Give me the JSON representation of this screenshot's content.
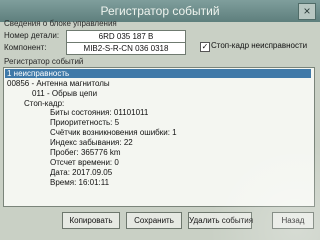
{
  "window": {
    "title": "Регистратор событий",
    "close_glyph": "×"
  },
  "control_unit": {
    "group_label": "Сведения о блоке управления",
    "part_number_label": "Номер детали:",
    "part_number": "6RD 035 187 B",
    "component_label": "Компонент:",
    "component_value": "MIB2-S-R-CN 036 0318",
    "freeze_frame_checked": true,
    "freeze_frame_label": "Стоп-кадр неисправности"
  },
  "event_log": {
    "label": "Регистратор событий",
    "lines": [
      "1 неисправность",
      "00856 - Антенна магнитолы",
      "011 - Обрыв цепи",
      "Стоп-кадр:",
      "Биты состояния: 01101011",
      "Приоритетность: 5",
      "Счётчик возникновения ошибки: 1",
      "Индекс забывания: 22",
      "Пробег: 365776 km",
      "Отсчет времени: 0",
      "Дата: 2017.09.05",
      "Время: 16:01:11"
    ]
  },
  "buttons": {
    "copy": "Копировать",
    "save": "Сохранить",
    "delete": "Удалить события",
    "back": "Назад"
  }
}
